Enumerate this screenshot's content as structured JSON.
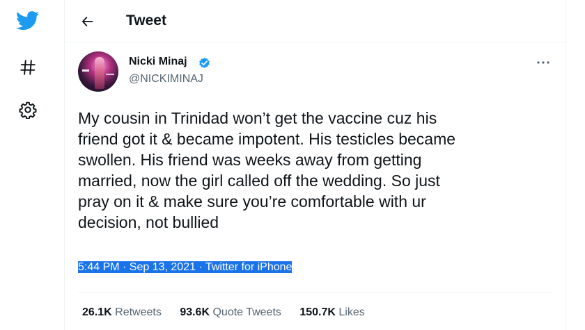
{
  "nav": {
    "icons": [
      "twitter-bird-icon",
      "hashtag-icon",
      "gear-icon"
    ],
    "brand_color": "#1d9bf0"
  },
  "header": {
    "back_icon": "arrow-left-icon",
    "title": "Tweet"
  },
  "tweet": {
    "author_name": "Nicki Minaj",
    "handle": "@NICKIMINAJ",
    "verified": true,
    "text": "My cousin in Trinidad won’t get the vaccine cuz his\nfriend got it & became impotent. His testicles became\nswollen. His friend was weeks away from getting\nmarried, now the girl called off the wedding. So just\npray on it & make sure you’re comfortable with ur\ndecision, not bullied",
    "timestamp": "5:44 PM · Sep 13, 2021",
    "separator": "·",
    "source": "Twitter for iPhone",
    "selection_color": "#1a73e8"
  },
  "stats": {
    "retweets_count": "26.1K",
    "retweets_label": "Retweets",
    "quotes_count": "93.6K",
    "quotes_label": "Quote Tweets",
    "likes_count": "150.7K",
    "likes_label": "Likes"
  }
}
